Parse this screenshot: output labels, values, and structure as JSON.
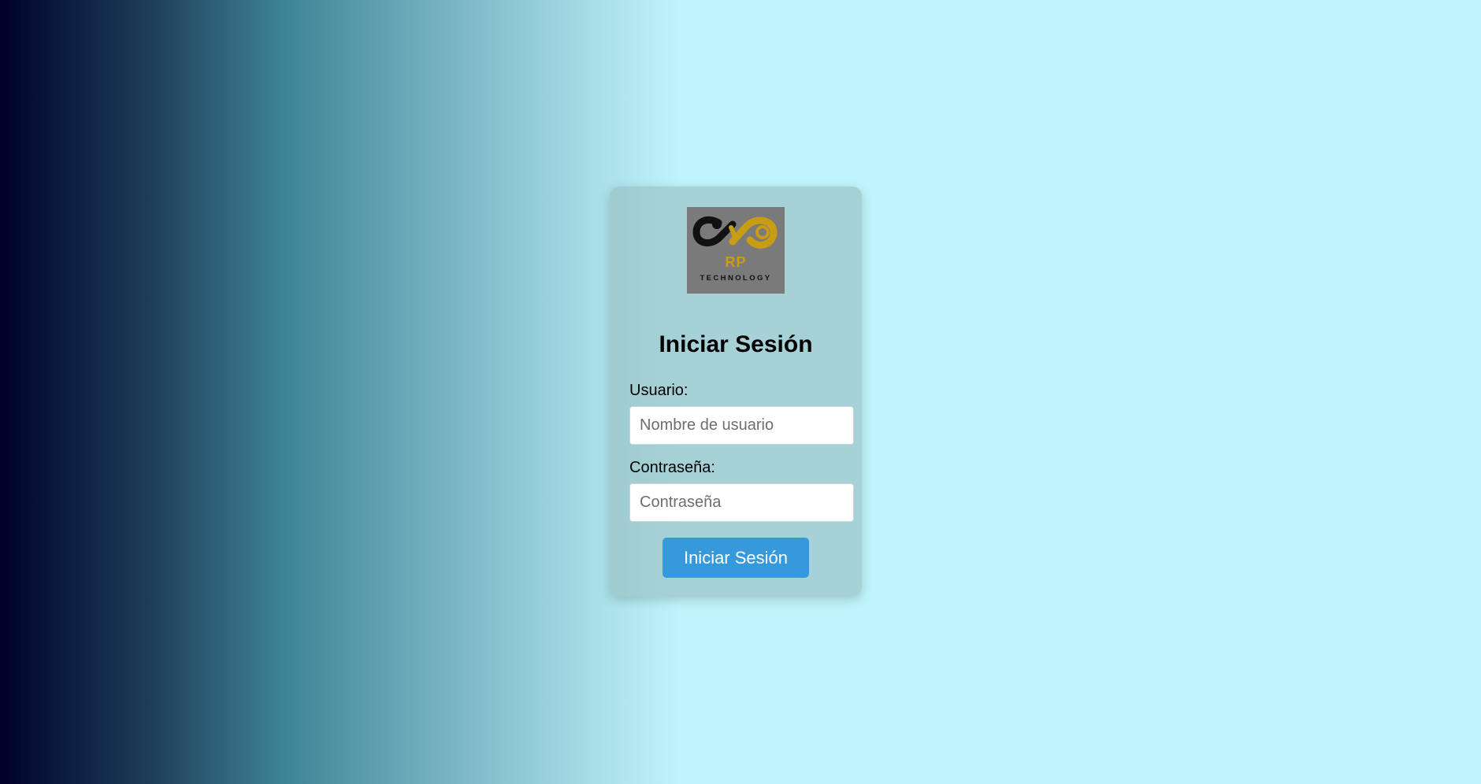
{
  "login": {
    "title": "Iniciar Sesión",
    "logo": {
      "mark_text": "RP",
      "subtitle": "TECHNOLOGY",
      "colors": {
        "background": "#7a7a7a",
        "gold": "#c89c14",
        "dark": "#111111"
      }
    },
    "username": {
      "label": "Usuario:",
      "placeholder": "Nombre de usuario",
      "value": ""
    },
    "password": {
      "label": "Contraseña:",
      "placeholder": "Contraseña",
      "value": ""
    },
    "submit_label": "Iniciar Sesión"
  },
  "colors": {
    "button": "#3699db",
    "background_light": "#c0f4fc",
    "background_dark": "#00002a"
  }
}
